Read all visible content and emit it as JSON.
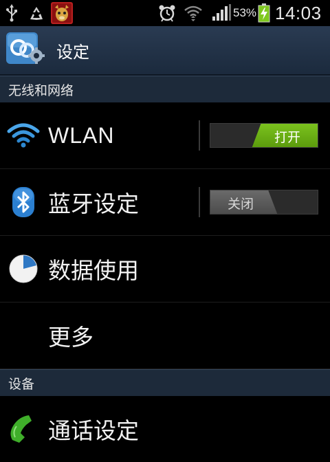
{
  "status_bar": {
    "battery_percent": "53%",
    "time": "14:03",
    "icons": [
      "usb-icon",
      "recycle-icon",
      "app-notification-icon",
      "alarm-icon",
      "wifi-status-icon",
      "signal-icon",
      "battery-charging-icon"
    ]
  },
  "action_bar": {
    "title": "设定",
    "icon": "settings-gear-icon"
  },
  "sections": {
    "wireless": "无线和网络",
    "device": "设备"
  },
  "rows": {
    "wlan": {
      "label": "WLAN",
      "toggle": "打开",
      "icon": "wifi-icon"
    },
    "bluetooth": {
      "label": "蓝牙设定",
      "toggle": "关闭",
      "icon": "bluetooth-icon"
    },
    "data_usage": {
      "label": "数据使用",
      "icon": "pie-chart-icon"
    },
    "more": {
      "label": "更多"
    },
    "call": {
      "label": "通话设定",
      "icon": "phone-icon"
    }
  },
  "colors": {
    "action_bar": "#1b2a3d",
    "section_header": "#1d2a3a",
    "toggle_on": "#6db319",
    "background": "#000000"
  }
}
